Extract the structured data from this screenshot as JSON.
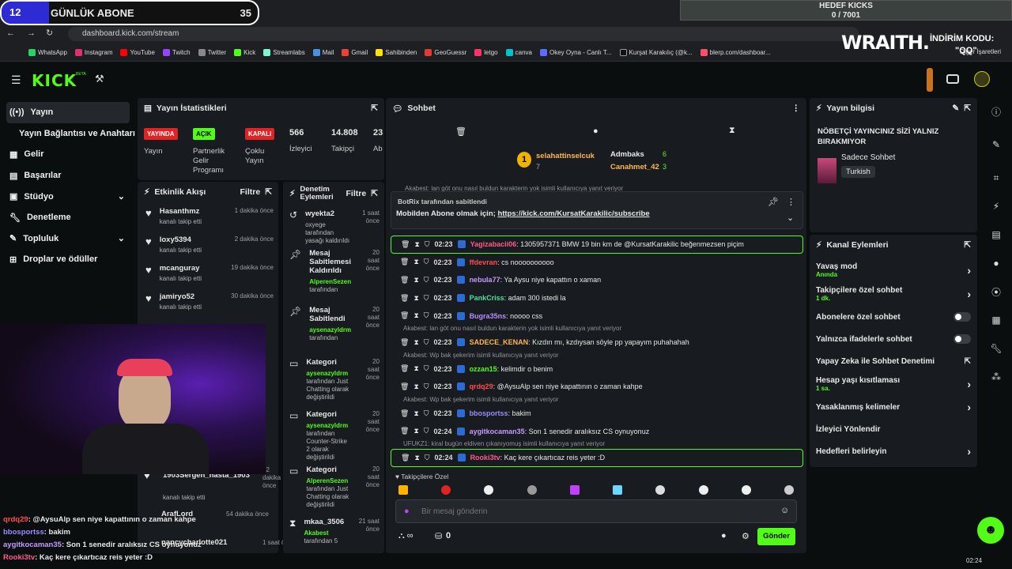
{
  "browser": {
    "url": "dashboard.kick.com/stream",
    "bookmarks": [
      "WhatsApp",
      "Instagram",
      "YouTube",
      "Twitch",
      "Twitter",
      "Kick",
      "Streamlabs",
      "Mail",
      "Gmail",
      "Sahibinden",
      "GeoGuessr",
      "letgo",
      "canva",
      "Okey Oyna - Canlı T...",
      "Kurşat Karakılıç (@k...",
      "blerp.com/dashboar..."
    ],
    "other_bookmarks": "Diğer İşaretleri"
  },
  "overlay": {
    "sub_count": "12",
    "sub_label": "GÜNLÜK ABONE",
    "sub_goal": "35",
    "goal_title": "HEDEF KICKS",
    "goal_value": "0 / 7001",
    "brand": "WRAITH.",
    "discount_label": "İNDİRİM KODU:",
    "discount_code": "\"QQ\""
  },
  "nav": {
    "logo": "KICK",
    "beta": "BETA"
  },
  "sidebar": {
    "items": [
      {
        "label": "Yayın",
        "icon": "broadcast-icon"
      },
      {
        "label": "Yayın Bağlantısı ve Anahtarı"
      },
      {
        "label": "Gelir",
        "icon": "revenue-icon"
      },
      {
        "label": "Başarılar",
        "icon": "trophy-icon"
      },
      {
        "label": "Stüdyo",
        "icon": "studio-icon"
      },
      {
        "label": "Denetleme",
        "icon": "wrench-icon"
      },
      {
        "label": "Topluluk",
        "icon": "community-icon"
      },
      {
        "label": "Droplar ve ödüller",
        "icon": "gift-icon"
      }
    ]
  },
  "stats": {
    "title": "Yayın İstatistikleri",
    "live_badge": "YAYINDA",
    "live_label": "Yayın",
    "partner_badge": "AÇIK",
    "partner_label": "Partnerlik Gelir Programı",
    "multi_badge": "KAPALI",
    "multi_label": "Çoklu Yayın",
    "viewers": "566",
    "viewers_label": "İzleyici",
    "followers": "14.808",
    "followers_label": "Takipçi",
    "subs": "23",
    "subs_label": "Ab"
  },
  "activity": {
    "title": "Etkinlik Akışı",
    "filter": "Filtre",
    "items": [
      {
        "name": "Hasanthmz",
        "sub": "kanalı takip etti",
        "time": "1 dakika önce"
      },
      {
        "name": "loxy5394",
        "sub": "kanalı takip etti",
        "time": "2 dakika önce"
      },
      {
        "name": "mcanguray",
        "sub": "kanalı takip etti",
        "time": "19 dakika önce"
      },
      {
        "name": "jamiryo52",
        "sub": "kanalı takip etti",
        "time": "30 dakika önce"
      },
      {
        "name": "1903Sergen_hasta_1903",
        "sub": "kanalı takip etti",
        "time": "52 dakika önce"
      },
      {
        "name": "ArafLord",
        "sub": "",
        "time": "54 dakika önce"
      },
      {
        "name": "nancycharlotte021",
        "sub": "",
        "time": "1 saat önce"
      }
    ]
  },
  "modactions": {
    "title": "Denetim Eylemleri",
    "filter": "Filtre",
    "items": [
      {
        "title": "wyekta2",
        "time": "1 saat önce",
        "desc": "oxyege tarafından yasağı kaldırıldı"
      },
      {
        "title": "Mesaj Sabitlemesi Kaldırıldı",
        "time": "20 saat önce",
        "actor": "AlperenSezen",
        "desc": "tarafından"
      },
      {
        "title": "Mesaj Sabitlendi",
        "time": "20 saat önce",
        "actor": "aysenazyldrm",
        "desc": "tarafından"
      },
      {
        "title": "Kategori",
        "time": "20 saat önce",
        "actor": "aysenazyldrm",
        "desc": "tarafından Just Chatting olarak değiştirildi"
      },
      {
        "title": "Kategori",
        "time": "20 saat önce",
        "actor": "aysenazyldrm",
        "desc": "tarafından Counter-Strike 2 olarak değiştirildi"
      },
      {
        "title": "Kategori",
        "time": "20 saat önce",
        "actor": "AlperenSezen",
        "desc": "tarafından Just Chatting olarak değiştirildi"
      },
      {
        "title": "mkaa_3506",
        "time": "21 saat önce",
        "actor": "Akabest",
        "desc": "tarafından 5"
      }
    ]
  },
  "chat": {
    "title": "Sohbet",
    "top": [
      {
        "name": "selahattinselcuk",
        "count": "7"
      },
      {
        "name": "Admbaks",
        "count": "6"
      },
      {
        "name": "Canahmet_42",
        "count": "3"
      }
    ],
    "pinned_by": "BotRix tarafından sabitlendi",
    "pinned_text": "Mobilden Abone olmak için;",
    "pinned_link": "https://kick.com/KursatKarakilic/subscribe",
    "messages": [
      {
        "time": "02:23",
        "user": "Yagizabacii06",
        "color": "#ff5c8a",
        "text": ": 1305957371 BMW 19 bin km de @KursatKarakilic beğenmezsen piçim",
        "highlight": true
      },
      {
        "time": "02:23",
        "user": "ffdevran",
        "color": "#ff4d4d",
        "text": ": cs noooooooooo"
      },
      {
        "time": "02:23",
        "user": "nebula77",
        "color": "#c59bff",
        "text": ": Ya Aysu niye kapattın o xaman"
      },
      {
        "time": "02:23",
        "user": "PankCriss",
        "color": "#4de0a0",
        "text": ": adam 300 istedi la"
      },
      {
        "time": "02:23",
        "user": "Bugra35ns",
        "color": "#b98cff",
        "text": ": noooo css"
      },
      {
        "reply": "Akabest: lan göt onu nasıl buldun karakterin yok isimli kullanıcıya yanıt veriyor",
        "time": "02:23",
        "user": "SADECE_KENAN",
        "color": "#ffb84d",
        "text": ": Kızdın mı, kzdıysan söyle pp yapayım puhahahah"
      },
      {
        "reply": "Akabest: Wp bak şekerim isimli kullanıcıya yanıt veriyor",
        "time": "02:23",
        "user": "ozzan15",
        "color": "#53fc18",
        "text": ": kelimdir o benim"
      },
      {
        "time": "02:23",
        "user": "qrdq29",
        "color": "#ff4d4d",
        "text": ": @AysuAlp sen niye kapattının o zaman kahpe"
      },
      {
        "reply": "Akabest: Wp bak şekerim isimli kullanıcıya yanıt veriyor",
        "time": "02:23",
        "user": "bbosportss",
        "color": "#9a8cff",
        "text": ": bakim"
      },
      {
        "time": "02:24",
        "user": "aygitkocaman35",
        "color": "#c59bff",
        "text": ": Son 1 senedir aralıksız CS oynuyonuz"
      },
      {
        "reply": "UFUKZ1: kiral bugün eldiven çıkanıyomuş isimli kullanıcıya yanıt veriyor",
        "time": "02:24",
        "user": "Rooki3tv",
        "color": "#ff5c8a",
        "text": ": Kaç kere çıkartıcaz reis yeter :D",
        "highlight": true
      }
    ],
    "emote_section": "Takipçilere Özel",
    "input_placeholder": "Bir mesaj gönderin",
    "points": "0",
    "send": "Gönder",
    "reply_top": "Akabest: lan göt onu nasıl buldun karakterin yok isimli kullanıcıya yanıt veriyor"
  },
  "info": {
    "title": "Yayın bilgisi",
    "stream_title": "NÖBETÇİ YAYINCINIZ SİZİ YALNIZ BIRAKMIYOR",
    "category": "Sadece Sohbet",
    "language": "Turkish"
  },
  "channel": {
    "title": "Kanal Eylemleri",
    "rows": [
      {
        "label": "Yavaş mod",
        "sub": "Anında",
        "type": "arrow"
      },
      {
        "label": "Takipçilere özel sohbet",
        "sub": "1 dk.",
        "type": "arrow"
      },
      {
        "label": "Abonelere özel sohbet",
        "type": "toggle"
      },
      {
        "label": "Yalnızca ifadelerle sohbet",
        "type": "toggle"
      },
      {
        "label": "Yapay Zeka ile Sohbet Denetimi",
        "type": "ext"
      },
      {
        "label": "Hesap yaşı kısıtlaması",
        "sub": "1 sa.",
        "type": "arrow"
      },
      {
        "label": "Yasaklanmış kelimeler",
        "type": "arrow"
      },
      {
        "label": "İzleyici Yönlendir",
        "type": "none"
      },
      {
        "label": "Hedefleri belirleyin",
        "type": "arrow"
      }
    ]
  },
  "overlay_chat": [
    {
      "user": "qrdq29",
      "color": "#ff4d4d",
      "text": ": @AysuAlp sen niye kapattının o zaman kahpe"
    },
    {
      "user": "bbosportss",
      "color": "#9a8cff",
      "text": ": bakim"
    },
    {
      "user": "aygitkocaman35",
      "color": "#c59bff",
      "text": ": Son 1 senedir aralıksız CS oynuyonuz"
    },
    {
      "user": "Rooki3tv",
      "color": "#ff5c8a",
      "text": ": Kaç kere çıkartıcaz reis yeter :D"
    }
  ],
  "clock": "02:24",
  "colors": {
    "accent": "#53fc18",
    "panel": "#181b1f",
    "bg": "#0b0e0f",
    "red": "#e02424"
  }
}
